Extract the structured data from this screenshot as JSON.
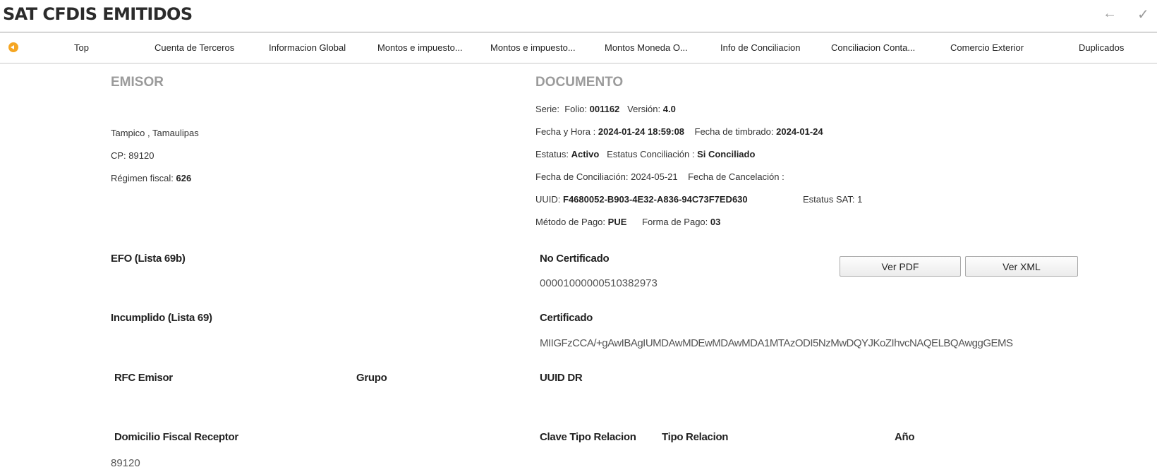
{
  "header": {
    "title": "SAT CFDIS EMITIDOS",
    "back_icon": "arrow-left-icon",
    "confirm_icon": "check-icon"
  },
  "tabs": [
    {
      "label": "Top"
    },
    {
      "label": "Cuenta de Terceros"
    },
    {
      "label": "Informacion Global"
    },
    {
      "label": "Montos e impuesto..."
    },
    {
      "label": "Montos e impuesto..."
    },
    {
      "label": "Montos Moneda O..."
    },
    {
      "label": "Info de Conciliacion"
    },
    {
      "label": "Conciliacion Conta..."
    },
    {
      "label": "Comercio Exterior"
    },
    {
      "label": "Duplicados"
    }
  ],
  "emisor": {
    "title": "EMISOR",
    "location": "Tampico , Tamaulipas",
    "cp": "CP: 89120",
    "regimen_label": "Régimen fiscal:",
    "regimen_value": "626"
  },
  "documento": {
    "title": "DOCUMENTO",
    "serie_label": "Serie:",
    "folio_label": "Folio:",
    "folio_value": "001162",
    "version_label": "Versión:",
    "version_value": "4.0",
    "fecha_hora_label": "Fecha y Hora :",
    "fecha_hora_value": "2024-01-24 18:59:08",
    "fecha_timbrado_label": "Fecha de timbrado:",
    "fecha_timbrado_value": "2024-01-24",
    "estatus_label": "Estatus:",
    "estatus_value": "Activo",
    "estatus_conc_label": "Estatus Conciliación :",
    "estatus_conc_value": "Si Conciliado",
    "fecha_conc": "Fecha de Conciliación: 2024-05-21",
    "fecha_cancel_label": "Fecha de Cancelación :",
    "uuid_label": "UUID:",
    "uuid_value": "F4680052-B903-4E32-A836-94C73F7ED630",
    "estatus_sat": "Estatus SAT:  1",
    "metodo_label": "Método de Pago:",
    "metodo_value": "PUE",
    "forma_label": "Forma de Pago:",
    "forma_value": "03"
  },
  "fields": {
    "efo_label": "EFO (Lista 69b)",
    "incumplido_label": "Incumplido (Lista 69)",
    "rfc_emisor_label": "RFC Emisor",
    "grupo_label": "Grupo",
    "domicilio_label": "Domicilio Fiscal Receptor",
    "domicilio_value": "89120",
    "no_certificado_label": "No Certificado",
    "no_certificado_value": "00001000000510382973",
    "certificado_label": "Certificado",
    "certificado_value": "MIIGFzCCA/+gAwIBAgIUMDAwMDEwMDAwMDA1MTAzODI5NzMwDQYJKoZIhvcNAQELBQAwggGEMS",
    "uuid_dr_label": "UUID DR",
    "clave_tipo_label": "Clave Tipo Relacion",
    "tipo_relacion_label": "Tipo Relacion",
    "anio_label": "Año"
  },
  "buttons": {
    "ver_pdf": "Ver PDF",
    "ver_xml": "Ver XML"
  }
}
